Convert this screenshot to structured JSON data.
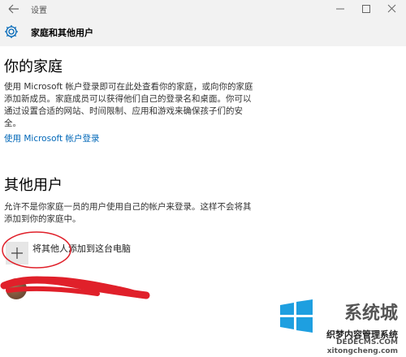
{
  "window": {
    "title": "设置"
  },
  "header": {
    "title": "家庭和其他用户"
  },
  "family": {
    "heading": "你的家庭",
    "desc_lines": [
      "使用 Microsoft 帐户登录即可在此处查看你的家庭，或向你的家庭",
      "添加新成员。家庭成员可以获得他们自己的登录名和桌面。你可以",
      "通过设置合适的网站、时间限制、应用和游戏来确保孩子们的安",
      "全。"
    ],
    "signin_link": "使用 Microsoft 帐户登录"
  },
  "others": {
    "heading": "其他用户",
    "desc_lines": [
      "允许不是你家庭一员的用户使用自己的帐户来登录。这样不会将其",
      "添加到你的家庭中。"
    ],
    "add_label": "将其他人添加到这台电脑"
  },
  "watermark": {
    "line1": "系统城",
    "line2": "织梦内容管理系统",
    "line3": "DEDECMS.COM",
    "line4": "xitongcheng.com"
  },
  "colors": {
    "accent": "#0067b8",
    "annotation": "#e0202a"
  }
}
